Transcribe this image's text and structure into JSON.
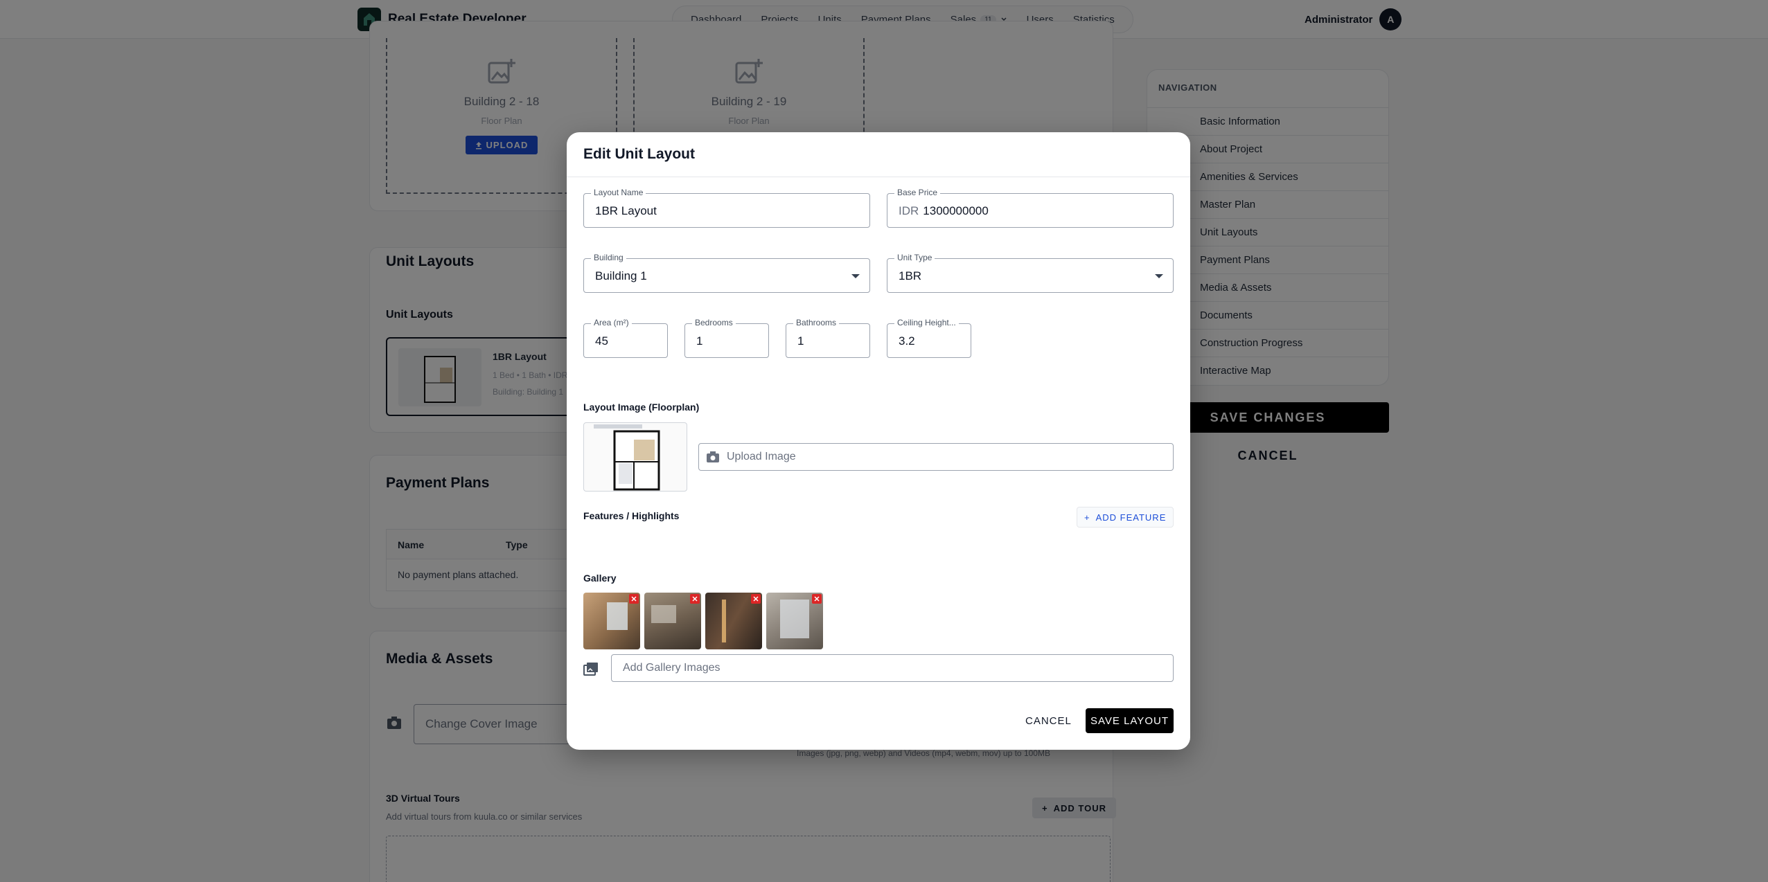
{
  "app": {
    "title": "Real Estate Developer"
  },
  "nav": {
    "items": [
      "Dashboard",
      "Projects",
      "Units",
      "Payment Plans"
    ],
    "sales": {
      "label": "Sales",
      "badge": "11"
    },
    "users": "Users",
    "statistics": "Statistics"
  },
  "user": {
    "name": "Administrator",
    "initial": "A"
  },
  "background": {
    "floorplans": [
      {
        "title": "Building 2 - 18",
        "sub": "Floor Plan",
        "upload": "UPLOAD"
      },
      {
        "title": "Building 2 - 19",
        "sub": "Floor Plan"
      }
    ],
    "unit_layouts_title": "Unit Layouts",
    "unit_layouts_sub": "Unit Layouts",
    "layout_card": {
      "name": "1BR Layout",
      "meta": "1 Bed • 1 Bath • IDR",
      "building": "Building: Building 1"
    },
    "payment_plans_title": "Payment Plans",
    "table_headers": [
      "Name",
      "Type"
    ],
    "table_empty": "No payment plans attached.",
    "media_title": "Media & Assets",
    "cover_placeholder": "Change Cover Image",
    "media_hint": "Images (jpg, png, webp) and Videos (mp4, webm, mov) up to 100MB",
    "tours_title": "3D Virtual Tours",
    "tours_sub": "Add virtual tours from kuula.co or similar services",
    "add_tour": "ADD TOUR"
  },
  "sidebar": {
    "title": "NAVIGATION",
    "items": [
      "Basic Information",
      "About Project",
      "Amenities & Services",
      "Master Plan",
      "Unit Layouts",
      "Payment Plans",
      "Media & Assets",
      "Documents",
      "Construction Progress",
      "Interactive Map"
    ],
    "save": "SAVE CHANGES",
    "cancel": "CANCEL"
  },
  "modal": {
    "title": "Edit Unit Layout",
    "layout_name": {
      "label": "Layout Name",
      "value": "1BR Layout"
    },
    "base_price": {
      "label": "Base Price",
      "prefix": "IDR",
      "value": "1300000000"
    },
    "building": {
      "label": "Building",
      "value": "Building 1"
    },
    "unit_type": {
      "label": "Unit Type",
      "value": "1BR"
    },
    "area": {
      "label": "Area (m²)",
      "value": "45"
    },
    "bedrooms": {
      "label": "Bedrooms",
      "value": "1"
    },
    "bathrooms": {
      "label": "Bathrooms",
      "value": "1"
    },
    "ceiling": {
      "label": "Ceiling Height...",
      "value": "3.2"
    },
    "layout_image_label": "Layout Image (Floorplan)",
    "upload_placeholder": "Upload Image",
    "features_label": "Features / Highlights",
    "add_feature": "ADD FEATURE",
    "gallery_label": "Gallery",
    "gallery_placeholder": "Add Gallery Images",
    "cancel": "CANCEL",
    "save": "SAVE LAYOUT"
  },
  "colors": {
    "accent": "#1d4ed8",
    "primary": "#000000",
    "danger": "#dc2626",
    "overlay": "rgba(0,0,0,0.5)"
  }
}
